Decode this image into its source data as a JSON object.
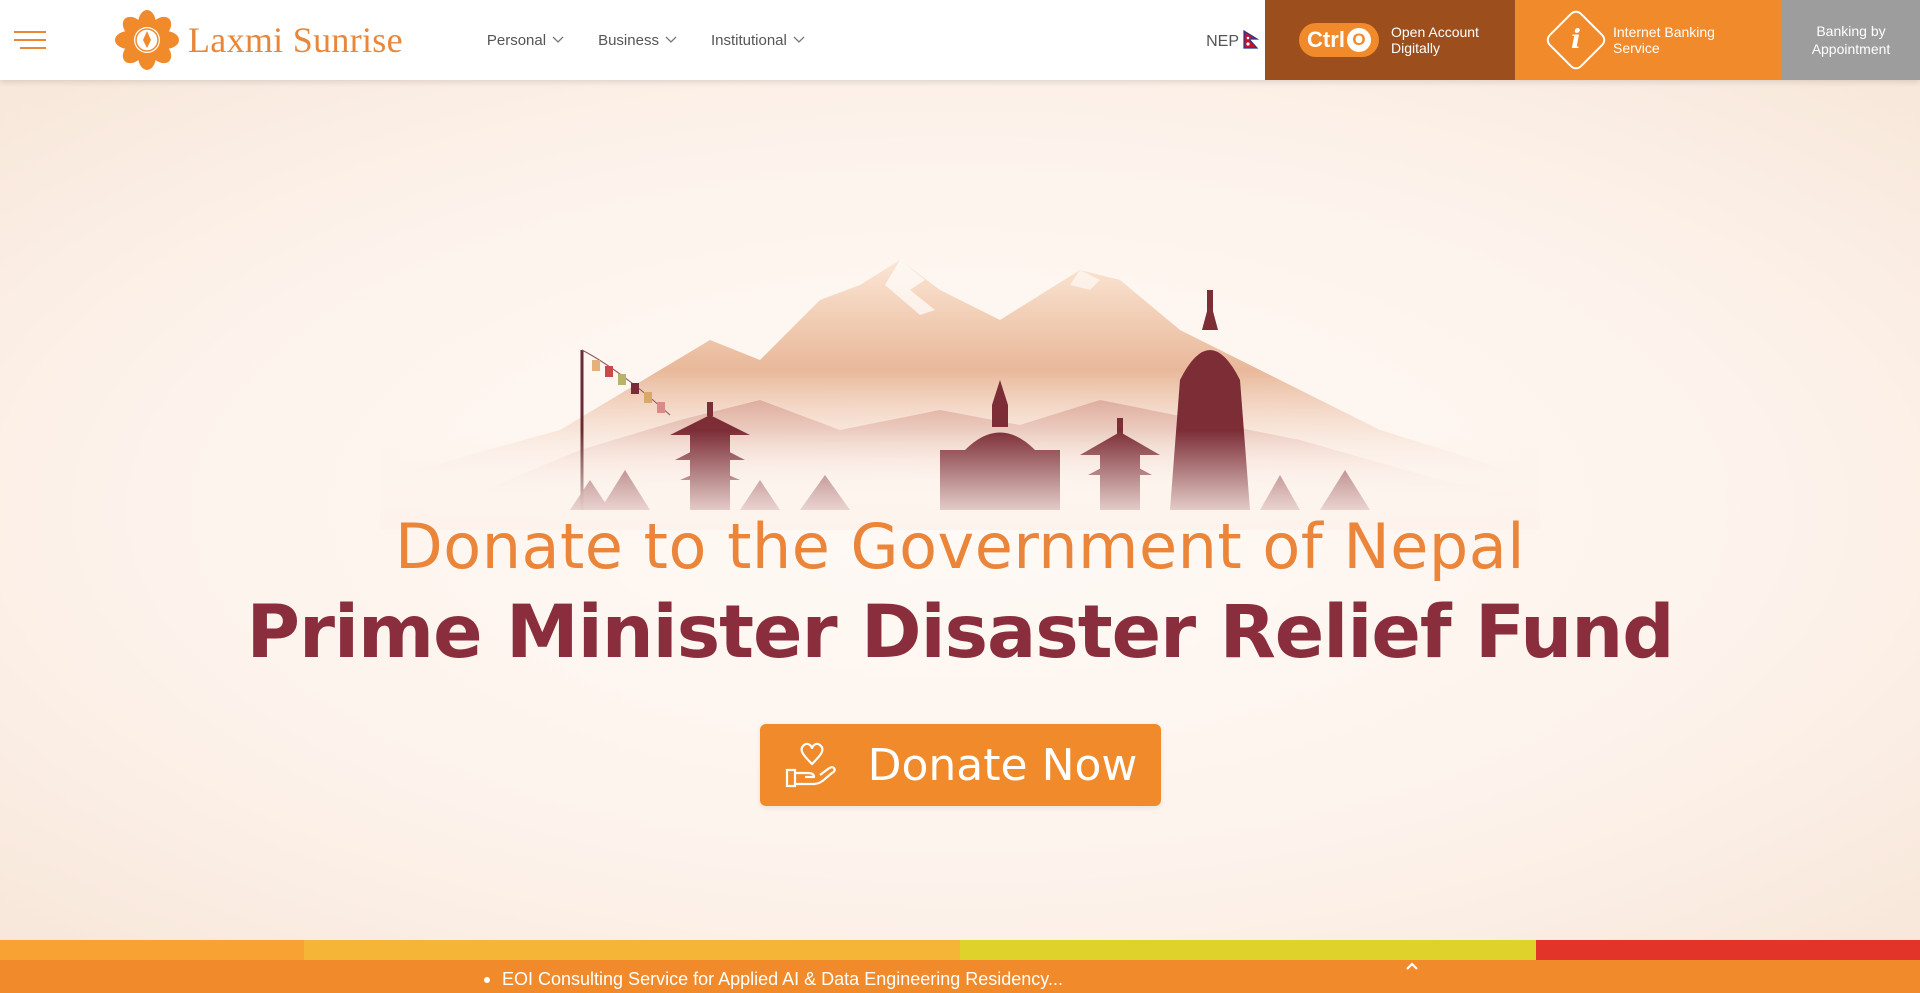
{
  "header": {
    "brand": "Laxmi Sunrise",
    "nav": [
      {
        "label": "Personal"
      },
      {
        "label": "Business"
      },
      {
        "label": "Institutional"
      }
    ],
    "language": "NEP",
    "cta_ctrl": {
      "pill": "Ctrl",
      "pill_o": "O",
      "line1": "Open Account",
      "line2": "Digitally"
    },
    "cta_ibank": {
      "badge": "i",
      "line1": "Internet Banking",
      "line2": "Service"
    },
    "cta_appoint": {
      "line1": "Banking by",
      "line2": "Appointment"
    }
  },
  "hero": {
    "headline": "Donate to the Government of Nepal",
    "subheadline": "Prime Minister Disaster Relief Fund",
    "button_label": "Donate Now"
  },
  "ticker": {
    "item": "EOI Consulting Service for Applied AI & Data Engineering Residency..."
  },
  "colors": {
    "brand_orange": "#f08a2a",
    "brand_brown": "#9c4f1c",
    "maroon": "#8a2d3c",
    "grey_cta": "#9d9d9d"
  },
  "icons": [
    "hamburger-icon",
    "lotus-logo-icon",
    "chevron-down-icon",
    "nepal-flag-icon",
    "heart-hand-icon",
    "chevron-up-icon"
  ]
}
